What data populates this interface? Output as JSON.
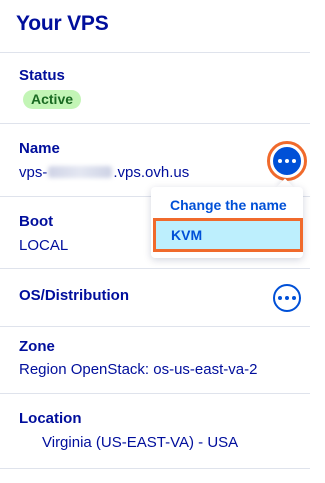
{
  "panel": {
    "title": "Your VPS"
  },
  "status": {
    "label": "Status",
    "badge": "Active"
  },
  "name": {
    "label": "Name",
    "value_prefix": "vps-",
    "value_suffix": ".vps.ovh.us",
    "actions_icon": "ellipsis-icon"
  },
  "menu": {
    "items": [
      {
        "label": "Change the name"
      },
      {
        "label": "KVM"
      }
    ]
  },
  "boot": {
    "label": "Boot",
    "value": "LOCAL"
  },
  "os": {
    "label": "OS/Distribution",
    "actions_icon": "ellipsis-icon"
  },
  "zone": {
    "label": "Zone",
    "value": "Region OpenStack: os-us-east-va-2"
  },
  "location": {
    "label": "Location",
    "value": "Virginia (US-EAST-VA) - USA"
  },
  "colors": {
    "heading": "#000e9c",
    "accent": "#0050d7",
    "badge_bg": "#c3f5b6",
    "highlight": "#f06a2c",
    "menu_hover": "#bdeffd"
  }
}
